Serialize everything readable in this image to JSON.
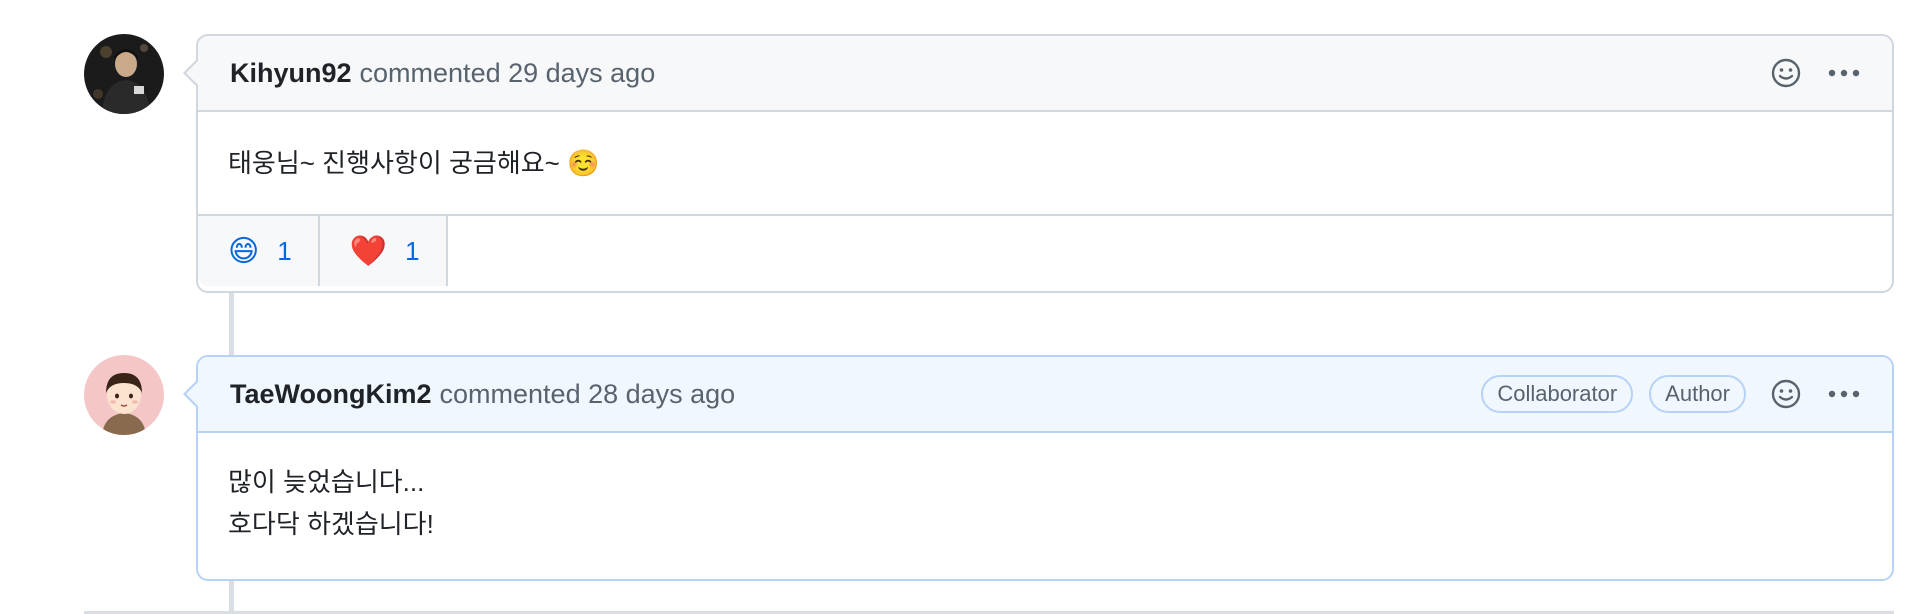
{
  "comments": [
    {
      "author": "Kihyun92",
      "meta": "commented 29 days ago",
      "labels": [],
      "body": [
        "태웅님~ 진행사항이 궁금해요~ ☺️"
      ],
      "reactions": [
        {
          "emoji": "😄",
          "count": "1"
        },
        {
          "emoji": "❤️",
          "count": "1"
        }
      ],
      "avatar_icon": "photo-avatar"
    },
    {
      "author": "TaeWoongKim2",
      "meta": "commented 28 days ago",
      "labels": [
        "Collaborator",
        "Author"
      ],
      "body": [
        "많이 늦었습니다...",
        "호다닥 하겠습니다!"
      ],
      "reactions": [],
      "avatar_icon": "cartoon-avatar"
    }
  ],
  "icons": {
    "add_reaction": "smiley-icon",
    "more": "kebab-horizontal-icon"
  },
  "colors": {
    "link_blue": "#0969da",
    "author_highlight": "#f1f7ff",
    "border": "#d0d7de"
  }
}
